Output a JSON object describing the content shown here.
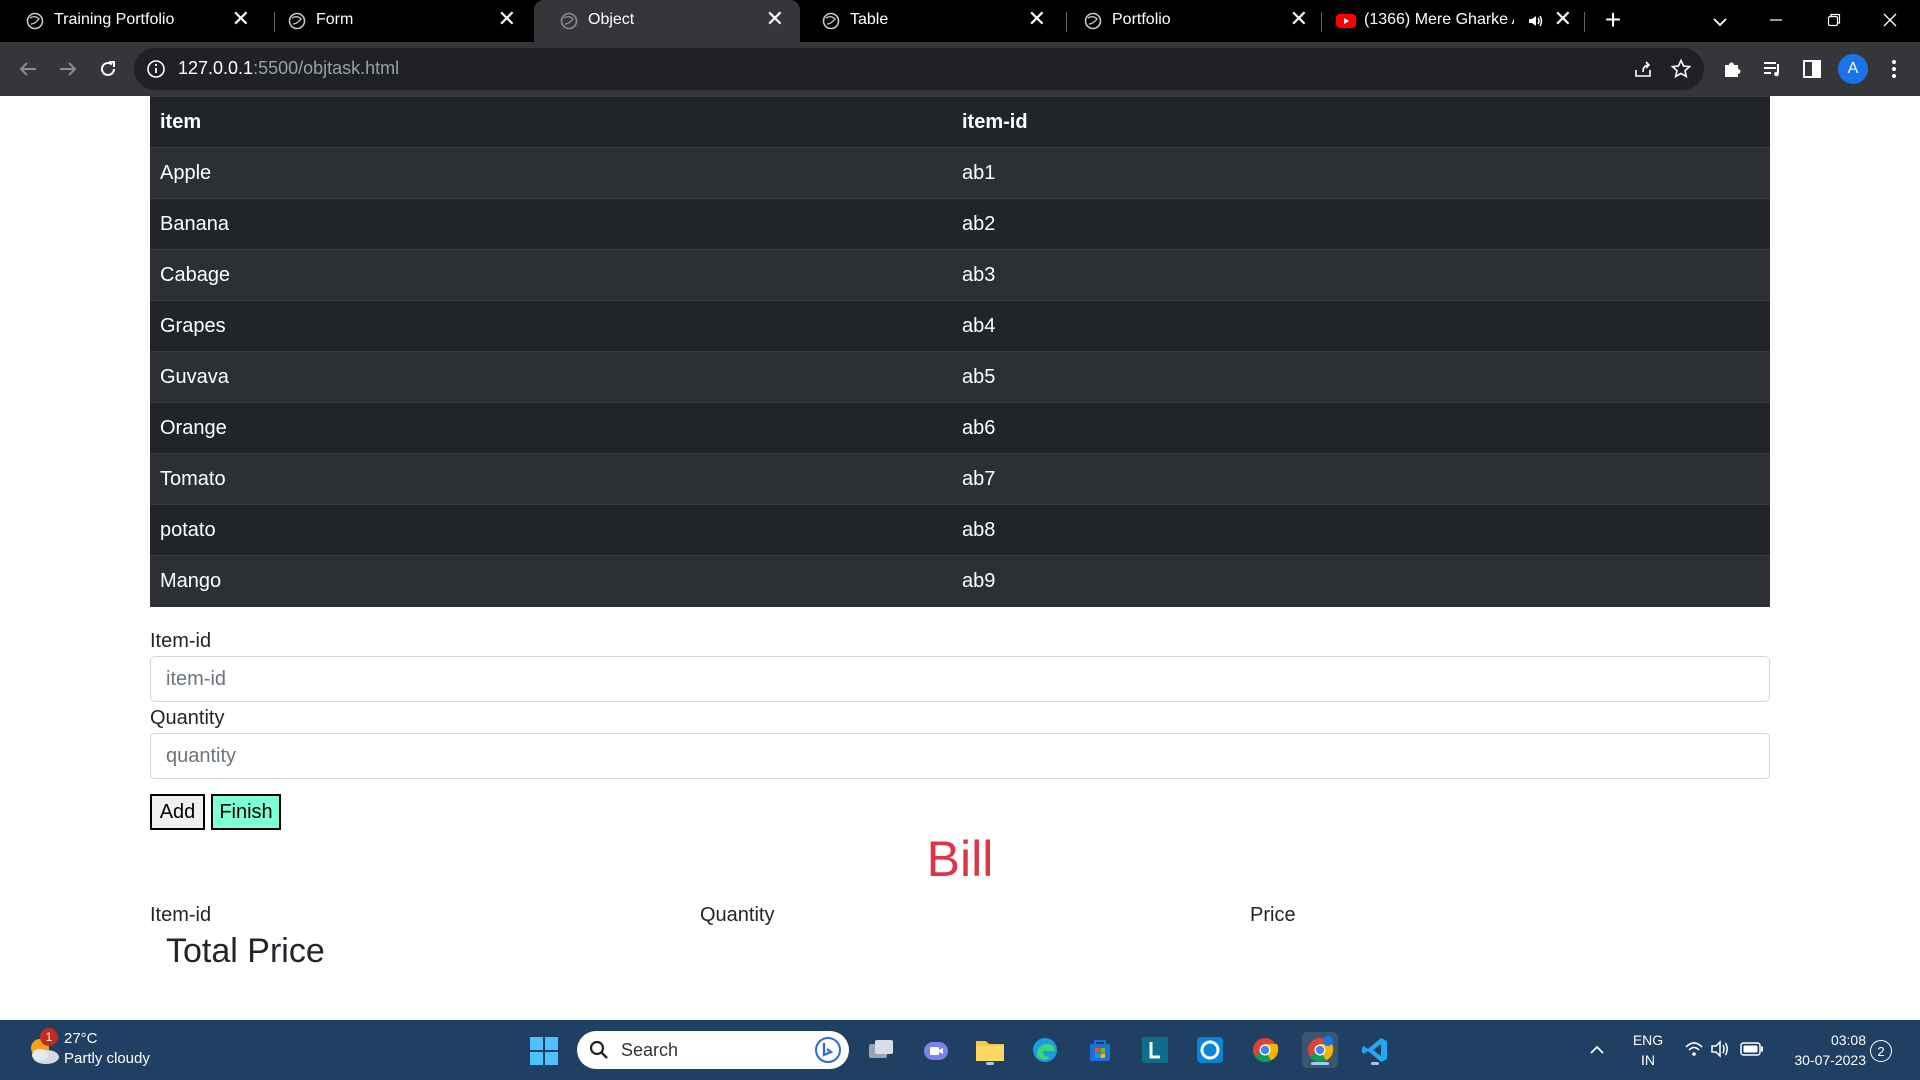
{
  "browser": {
    "tabs": [
      {
        "title": "Training Portfolio",
        "favicon": "globe-icon",
        "active": false
      },
      {
        "title": "Form",
        "favicon": "globe-icon",
        "active": false
      },
      {
        "title": "Object",
        "favicon": "globe-icon",
        "active": true
      },
      {
        "title": "Table",
        "favicon": "globe-icon",
        "active": false
      },
      {
        "title": "Portfolio",
        "favicon": "globe-icon",
        "active": false
      },
      {
        "title": "(1366) Mere Gharke Aa",
        "favicon": "youtube-icon",
        "active": false,
        "audio": true
      }
    ],
    "close_glyph": "✕",
    "new_tab_glyph": "+",
    "url_host": "127.0.0.1",
    "url_rest": ":5500/objtask.html",
    "profile_initial": "A"
  },
  "page": {
    "table": {
      "headers": [
        "item",
        "item-id"
      ],
      "rows": [
        [
          "Apple",
          "ab1"
        ],
        [
          "Banana",
          "ab2"
        ],
        [
          "Cabage",
          "ab3"
        ],
        [
          "Grapes",
          "ab4"
        ],
        [
          "Guvava",
          "ab5"
        ],
        [
          "Orange",
          "ab6"
        ],
        [
          "Tomato",
          "ab7"
        ],
        [
          "potato",
          "ab8"
        ],
        [
          "Mango",
          "ab9"
        ]
      ]
    },
    "form": {
      "item_id_label": "Item-id",
      "item_id_placeholder": "item-id",
      "item_id_value": "",
      "quantity_label": "Quantity",
      "quantity_placeholder": "quantity",
      "quantity_value": "",
      "add_label": "Add",
      "finish_label": "Finish"
    },
    "bill": {
      "title": "Bill",
      "col_item_id": "Item-id",
      "col_quantity": "Quantity",
      "col_price": "Price",
      "total_label": "Total Price"
    }
  },
  "taskbar": {
    "weather_badge": "1",
    "temperature": "27°C",
    "weather_desc": "Partly cloudy",
    "search_label": "Search",
    "lang_top": "ENG",
    "lang_bottom": "IN",
    "time": "03:08",
    "date": "30-07-2023",
    "notifications": "2"
  },
  "colors": {
    "table_dark": "#212529",
    "table_stripe": "#2c3034",
    "bill_red": "#dc3545",
    "finish_bg": "#7fffd4",
    "taskbar_bg": "#1f3f63"
  }
}
